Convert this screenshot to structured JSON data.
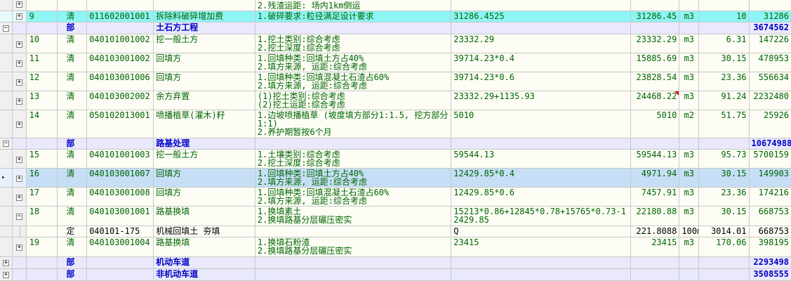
{
  "rows": [
    {
      "no": "",
      "type": "",
      "code": "",
      "name": "",
      "features": "2.残渣运距: 场内1km倒运",
      "expr": "",
      "qty": "",
      "unit": "",
      "price": "",
      "total": "",
      "toggle": "+"
    },
    {
      "no": "9",
      "type": "清",
      "code": "011602001001",
      "name": "拆除料破碎增加费",
      "features": "1.破碎要求:粒径满足设计要求",
      "expr": "31286.4525",
      "qty": "31286.45",
      "unit": "m3",
      "price": "10",
      "total": "31286",
      "toggle": "+"
    },
    {
      "no": "",
      "type": "部",
      "code": "",
      "name": "土石方工程",
      "features": "",
      "expr": "",
      "qty": "",
      "unit": "",
      "price": "",
      "total": "3674562",
      "toggle": "−"
    },
    {
      "no": "10",
      "type": "清",
      "code": "040101001002",
      "name": "挖一般土方",
      "features": "1.挖土类别:综合考虑\n2.挖土深度:综合考虑",
      "expr": "23332.29",
      "qty": "23332.29",
      "unit": "m3",
      "price": "6.31",
      "total": "147226",
      "toggle": "+"
    },
    {
      "no": "11",
      "type": "清",
      "code": "040103001002",
      "name": "回填方",
      "features": "1.回填种类:回填土方占40%\n2.填方来源, 运距:综合考虑",
      "expr": "39714.23*0.4",
      "qty": "15885.69",
      "unit": "m3",
      "price": "30.15",
      "total": "478953",
      "toggle": "+"
    },
    {
      "no": "12",
      "type": "清",
      "code": "040103001006",
      "name": "回填方",
      "features": "1.回填种类:回填混凝土石渣占60%\n2.填方来源, 运距:综合考虑",
      "expr": "39714.23*0.6",
      "qty": "23828.54",
      "unit": "m3",
      "price": "23.36",
      "total": "556634",
      "toggle": "+"
    },
    {
      "no": "13",
      "type": "清",
      "code": "040103002002",
      "name": "余方弃置",
      "features": "(1)挖土类别:综合考虑\n(2)挖土运距:综合考虑",
      "expr": "23332.29+1135.93",
      "qty": "24468.22",
      "unit": "m3",
      "price": "91.24",
      "total": "2232480",
      "toggle": "+"
    },
    {
      "no": "14",
      "type": "清",
      "code": "050102013001",
      "name": "喷播植草(灌木)籽",
      "features": "1.边坡喷播植草 (坡度填方部分1:1.5, 挖方部分1:1)\n2.养护期暂按6个月",
      "expr": "5010",
      "qty": "5010",
      "unit": "m2",
      "price": "51.75",
      "total": "25926",
      "toggle": "+"
    },
    {
      "no": "",
      "type": "部",
      "code": "",
      "name": "路基处理",
      "features": "",
      "expr": "",
      "qty": "",
      "unit": "",
      "price": "",
      "total": "10674988",
      "toggle": "−"
    },
    {
      "no": "15",
      "type": "清",
      "code": "040101001003",
      "name": "挖一般土方",
      "features": "1.土壤类别:综合考虑\n2.挖土深度:综合考虑",
      "expr": "59544.13",
      "qty": "59544.13",
      "unit": "m3",
      "price": "95.73",
      "total": "5700159",
      "toggle": "+"
    },
    {
      "no": "16",
      "type": "清",
      "code": "040103001007",
      "name": "回填方",
      "features": "1.回填种类:回填土方占40%\n2.填方来源, 运距:综合考虑",
      "expr": "12429.85*0.4",
      "qty": "4971.94",
      "unit": "m3",
      "price": "30.15",
      "total": "149903",
      "toggle": "+"
    },
    {
      "no": "17",
      "type": "清",
      "code": "040103001008",
      "name": "回填方",
      "features": "1.回填种类:回填混凝土石渣占60%\n2.填方来源, 运距:综合考虑",
      "expr": "12429.85*0.6",
      "qty": "7457.91",
      "unit": "m3",
      "price": "23.36",
      "total": "174216",
      "toggle": "+"
    },
    {
      "no": "18",
      "type": "清",
      "code": "040103001001",
      "name": "路基换填",
      "features": "1.换填素土\n2.换填路基分层碾压密实",
      "expr": "15213*0.86+12845*0.78+15765*0.73-12429.85",
      "qty": "22180.88",
      "unit": "m3",
      "price": "30.15",
      "total": "668753",
      "toggle": "−"
    },
    {
      "no": "",
      "type": "定",
      "code": "040101-175",
      "name": "机械回填土 夯填",
      "features": "",
      "expr": "Q",
      "qty": "221.8088",
      "unit": "100m3",
      "price": "3014.01",
      "total": "668753",
      "toggle": ""
    },
    {
      "no": "19",
      "type": "清",
      "code": "040103001004",
      "name": "路基换填",
      "features": "1.换填石粉渣\n2.换填路基分层碾压密实",
      "expr": "23415",
      "qty": "23415",
      "unit": "m3",
      "price": "170.06",
      "total": "398195",
      "toggle": "+"
    },
    {
      "no": "",
      "type": "部",
      "code": "",
      "name": "机动车道",
      "features": "",
      "expr": "",
      "qty": "",
      "unit": "",
      "price": "",
      "total": "2293498",
      "toggle": "+"
    },
    {
      "no": "",
      "type": "部",
      "code": "",
      "name": "非机动车道",
      "features": "",
      "expr": "",
      "qty": "",
      "unit": "",
      "price": "",
      "total": "3508555",
      "toggle": "+"
    }
  ],
  "icons": {
    "expand": "plus-box-icon",
    "collapse": "minus-box-icon",
    "row_pointer": "current-row-pointer-icon",
    "note_marker": "red-triangle-note-icon"
  }
}
